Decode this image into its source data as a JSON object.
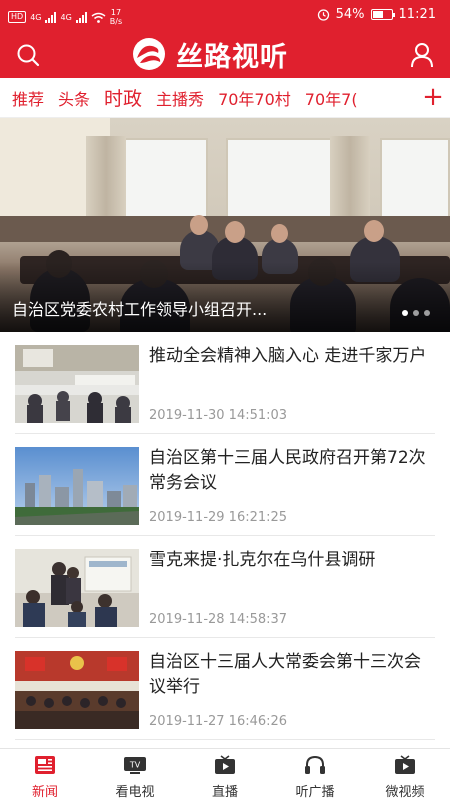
{
  "status_bar": {
    "network_badge": "HD",
    "signal_1": "4G",
    "signal_2": "4G",
    "speed": "17",
    "speed_unit": "B/s",
    "battery_percent": "54%",
    "battery_level": 0.54,
    "time": "11:21"
  },
  "header": {
    "logo_text": "丝路视听",
    "search_icon": "search-icon",
    "user_icon": "user-icon"
  },
  "tabs": {
    "items": [
      "推荐",
      "头条",
      "时政",
      "主播秀",
      "70年70村",
      "70年7("
    ],
    "active_index": 2,
    "plus": "+"
  },
  "banner": {
    "caption": "自治区党委农村工作领导小组召开...",
    "slide_count": 3,
    "active_slide": 0
  },
  "news": [
    {
      "title": "推动全会精神入脑入心 走进千家万户",
      "time": "2019-11-30 14:51:03"
    },
    {
      "title": "自治区第十三届人民政府召开第72次常务会议",
      "time": "2019-11-29 16:21:25"
    },
    {
      "title": "雪克来提·扎克尔在乌什县调研",
      "time": "2019-11-28 14:58:37"
    },
    {
      "title": "自治区十三届人大常委会第十三次会议举行",
      "time": "2019-11-27 16:46:26"
    }
  ],
  "bottom_nav": {
    "items": [
      {
        "label": "新闻",
        "icon": "news-icon"
      },
      {
        "label": "看电视",
        "icon": "tv-icon"
      },
      {
        "label": "直播",
        "icon": "live-icon"
      },
      {
        "label": "听广播",
        "icon": "headphones-icon"
      },
      {
        "label": "微视频",
        "icon": "video-icon"
      }
    ],
    "active_index": 0
  },
  "colors": {
    "brand_red": "#e0202e",
    "text_dark": "#222222",
    "text_muted": "#999999"
  }
}
